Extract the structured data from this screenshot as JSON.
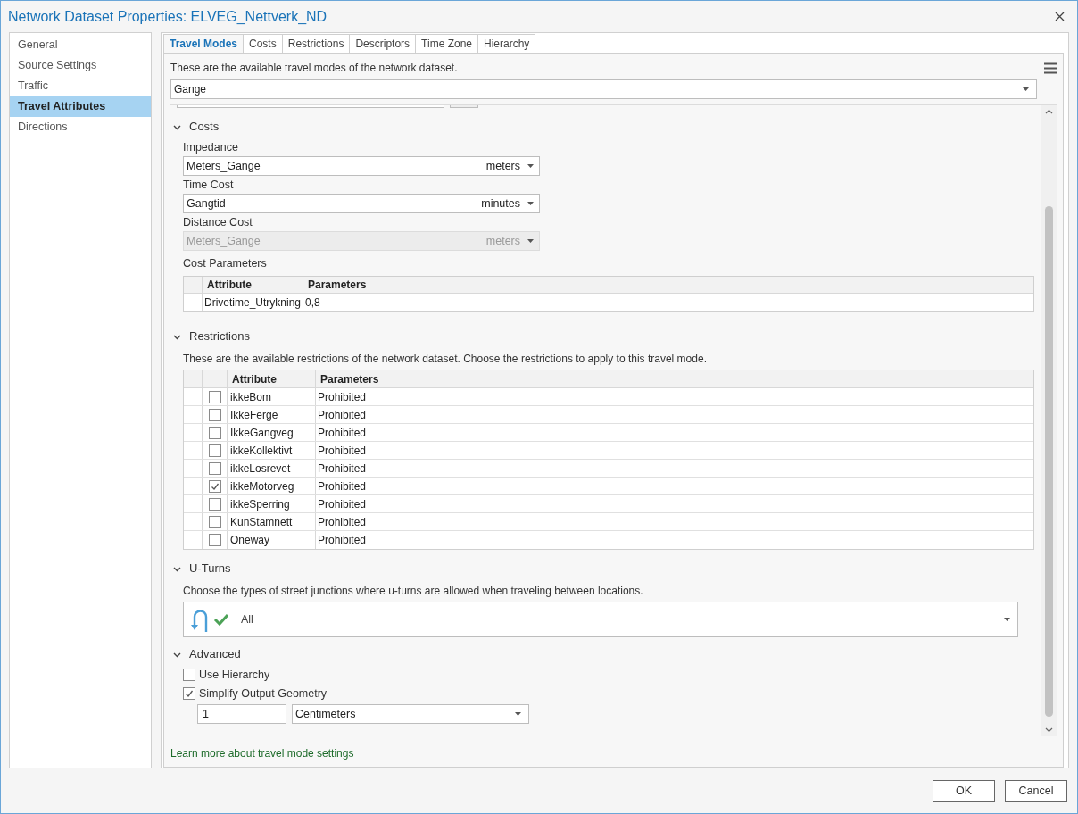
{
  "window": {
    "title": "Network Dataset Properties: ELVEG_Nettverk_ND"
  },
  "sidebar": {
    "items": [
      {
        "label": "General",
        "selected": false
      },
      {
        "label": "Source Settings",
        "selected": false
      },
      {
        "label": "Traffic",
        "selected": false
      },
      {
        "label": "Travel Attributes",
        "selected": true
      },
      {
        "label": "Directions",
        "selected": false
      }
    ]
  },
  "tabs": [
    {
      "label": "Travel Modes",
      "selected": true
    },
    {
      "label": "Costs",
      "selected": false
    },
    {
      "label": "Restrictions",
      "selected": false
    },
    {
      "label": "Descriptors",
      "selected": false
    },
    {
      "label": "Time Zone",
      "selected": false
    },
    {
      "label": "Hierarchy",
      "selected": false
    }
  ],
  "travel_modes": {
    "description": "These are the available travel modes of the network dataset.",
    "selected_mode": "Gange"
  },
  "costs": {
    "heading": "Costs",
    "expanded": true,
    "fields": [
      {
        "label": "Impedance",
        "value": "Meters_Gange",
        "unit": "meters",
        "disabled": false
      },
      {
        "label": "Time Cost",
        "value": "Gangtid",
        "unit": "minutes",
        "disabled": false
      },
      {
        "label": "Distance Cost",
        "value": "Meters_Gange",
        "unit": "meters",
        "disabled": true
      }
    ],
    "parameters_label": "Cost Parameters",
    "columns": [
      "Attribute",
      "Parameters"
    ],
    "rows": [
      {
        "attribute": "Drivetime_Utrykning",
        "parameters": "0,8"
      }
    ]
  },
  "restrictions": {
    "heading": "Restrictions",
    "expanded": true,
    "description": "These are the available restrictions of the network dataset. Choose the restrictions to apply to this travel mode.",
    "columns": [
      "Attribute",
      "Parameters"
    ],
    "rows": [
      {
        "checked": false,
        "attribute": "ikkeBom",
        "parameters": "Prohibited"
      },
      {
        "checked": false,
        "attribute": "IkkeFerge",
        "parameters": "Prohibited"
      },
      {
        "checked": false,
        "attribute": "IkkeGangveg",
        "parameters": "Prohibited"
      },
      {
        "checked": false,
        "attribute": "ikkeKollektivt",
        "parameters": "Prohibited"
      },
      {
        "checked": false,
        "attribute": "ikkeLosrevet",
        "parameters": "Prohibited"
      },
      {
        "checked": true,
        "attribute": "ikkeMotorveg",
        "parameters": "Prohibited"
      },
      {
        "checked": false,
        "attribute": "ikkeSperring",
        "parameters": "Prohibited"
      },
      {
        "checked": false,
        "attribute": "KunStamnett",
        "parameters": "Prohibited"
      },
      {
        "checked": false,
        "attribute": "Oneway",
        "parameters": "Prohibited"
      }
    ]
  },
  "u_turns": {
    "heading": "U-Turns",
    "expanded": true,
    "description": "Choose the types of street junctions where u-turns are allowed when traveling between locations.",
    "value": "All"
  },
  "advanced": {
    "heading": "Advanced",
    "expanded": true,
    "options": [
      {
        "label": "Use Hierarchy",
        "checked": false
      },
      {
        "label": "Simplify Output Geometry",
        "checked": true
      }
    ],
    "tolerance": {
      "value": "1",
      "unit": "Centimeters"
    }
  },
  "link": "Learn more about travel mode settings",
  "buttons": [
    {
      "label": "OK"
    },
    {
      "label": "Cancel"
    }
  ]
}
